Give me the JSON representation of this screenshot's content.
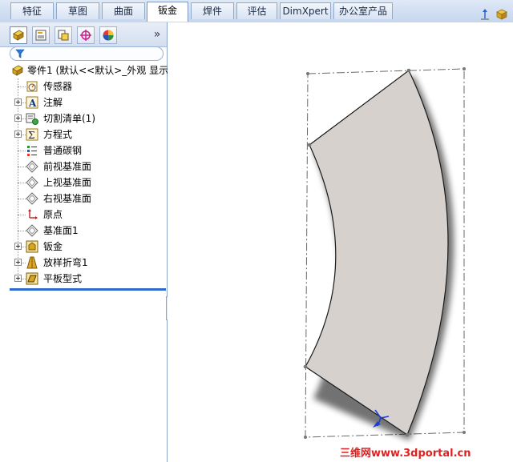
{
  "tabs": [
    {
      "label": "特征",
      "active": false
    },
    {
      "label": "草图",
      "active": false
    },
    {
      "label": "曲面",
      "active": false
    },
    {
      "label": "钣金",
      "active": true
    },
    {
      "label": "焊件",
      "active": false
    },
    {
      "label": "评估",
      "active": false
    },
    {
      "label": "DimXpert",
      "active": false
    },
    {
      "label": "办公室产品",
      "active": false
    }
  ],
  "panel": {
    "tab_icons": [
      "feature-manager-icon",
      "property-manager-icon",
      "configuration-manager-icon",
      "dimxpert-manager-icon",
      "display-manager-icon"
    ],
    "expand_glyph": "»"
  },
  "tree": {
    "root": {
      "label": "零件1  (默认<<默认>_外观 显示",
      "icon": "part-icon"
    },
    "items": [
      {
        "label": "传感器",
        "icon": "sensor-icon",
        "expandable": false
      },
      {
        "label": "注解",
        "icon": "annotation-icon",
        "expandable": true
      },
      {
        "label": "切割清单(1)",
        "icon": "cut-list-icon",
        "expandable": true
      },
      {
        "label": "方程式",
        "icon": "equation-icon",
        "expandable": true
      },
      {
        "label": "普通碳钢",
        "icon": "material-icon",
        "expandable": false
      },
      {
        "label": "前视基准面",
        "icon": "plane-icon",
        "expandable": false
      },
      {
        "label": "上视基准面",
        "icon": "plane-icon",
        "expandable": false
      },
      {
        "label": "右视基准面",
        "icon": "plane-icon",
        "expandable": false
      },
      {
        "label": "原点",
        "icon": "origin-icon",
        "expandable": false
      },
      {
        "label": "基准面1",
        "icon": "plane-icon",
        "expandable": false
      },
      {
        "label": "钣金",
        "icon": "sheet-metal-icon",
        "expandable": true
      },
      {
        "label": "放样折弯1",
        "icon": "lofted-bend-icon",
        "expandable": true
      },
      {
        "label": "平板型式",
        "icon": "flat-pattern-icon",
        "expandable": true
      }
    ]
  },
  "watermark": "三维网www.3dportal.cn",
  "colors": {
    "part_face": "#d6d1cd",
    "accent": "#2f6ad0",
    "watermark": "#e02020"
  }
}
